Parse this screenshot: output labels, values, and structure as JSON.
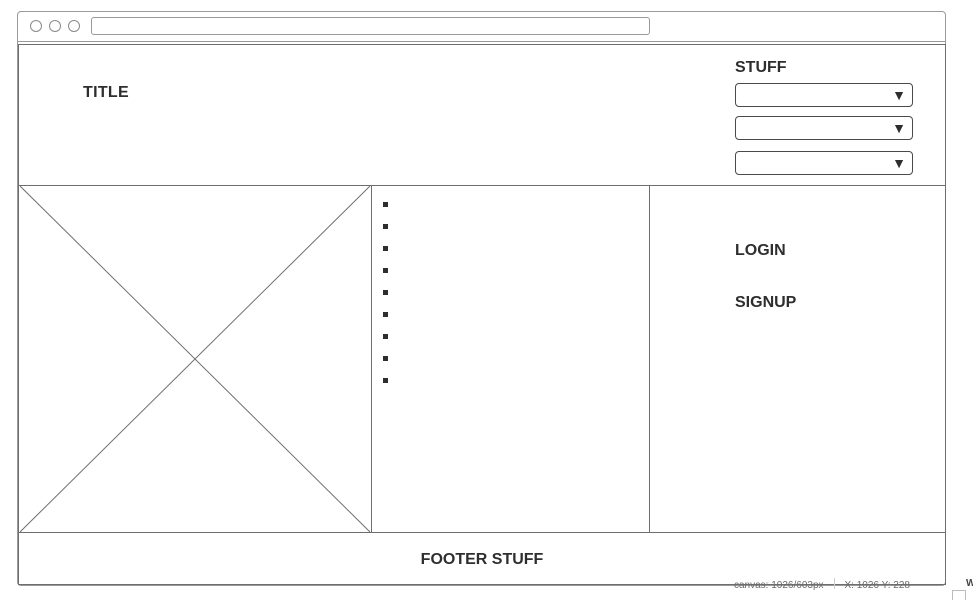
{
  "browser": {
    "url": ""
  },
  "header": {
    "title": "TITLE",
    "stuff_label": "STUFF",
    "selects": [
      {
        "value": "",
        "arrow": "▼"
      },
      {
        "value": "",
        "arrow": "▼"
      },
      {
        "value": "",
        "arrow": "▼"
      }
    ]
  },
  "list": {
    "item_count": 9
  },
  "auth": {
    "login_label": "LOGIN",
    "signup_label": "SIGNUP"
  },
  "footer": {
    "text": "FOOTER STUFF"
  },
  "status": {
    "canvas": "canvas: 1026/603px",
    "coords": "X: 1026 Y: 228",
    "corner": "W"
  }
}
